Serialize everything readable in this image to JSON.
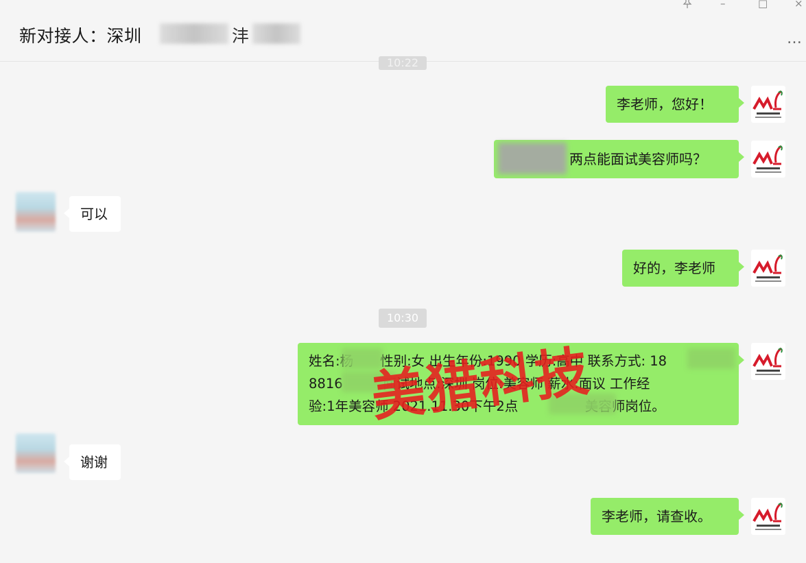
{
  "window": {
    "title": "新对接人：深圳",
    "title_suffix": "沣",
    "more": "…",
    "pin_icon": "pin-icon",
    "minimize": "–",
    "maximize": "□",
    "close": "×"
  },
  "time_badges": [
    "10:22",
    "10:30"
  ],
  "messages": [
    {
      "side": "right",
      "text": "李老师，您好！"
    },
    {
      "side": "right",
      "text": "两点能面试美容师吗？"
    },
    {
      "side": "left",
      "text": "可以"
    },
    {
      "side": "right",
      "text": "好的，李老师"
    },
    {
      "side": "right",
      "lines": [
        "姓名:杨　　性别:女 出生年份:1990 学历:高中 联系方式: 18",
        "8816　　　面试地点:深圳 岗位:美容师 薪水:面议 工作经",
        "验:1年美容师 2021.11.30下午2点　　　　　美容师岗位。"
      ]
    },
    {
      "side": "left",
      "text": "谢谢"
    },
    {
      "side": "right",
      "text": "李老师，请查收。"
    }
  ],
  "watermark": "美猎科技",
  "colors": {
    "bubble_self": "#95ec69",
    "bubble_other": "#ffffff",
    "background": "#f5f5f5",
    "watermark": "#e61e1e"
  }
}
